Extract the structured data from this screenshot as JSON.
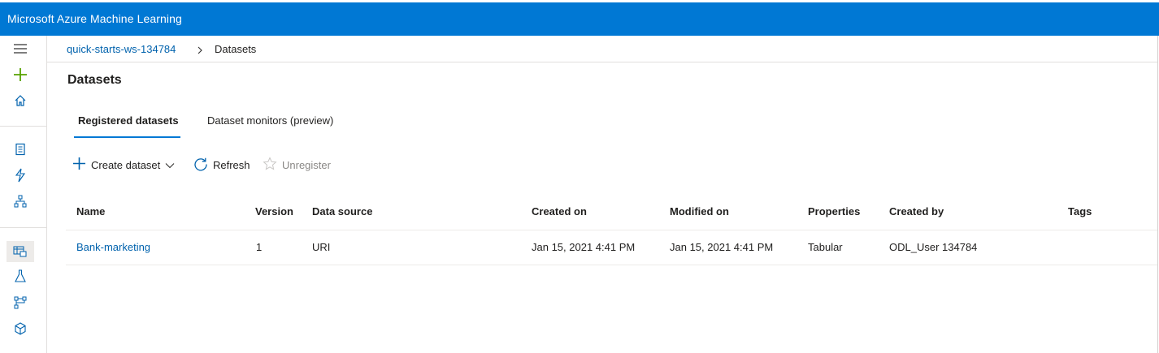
{
  "app": {
    "title": "Microsoft Azure Machine Learning"
  },
  "breadcrumb": {
    "workspace": "quick-starts-ws-134784",
    "current": "Datasets"
  },
  "page": {
    "title": "Datasets"
  },
  "tabs": [
    {
      "label": "Registered datasets",
      "active": true
    },
    {
      "label": "Dataset monitors (preview)",
      "active": false
    }
  ],
  "commands": {
    "create": "Create dataset",
    "refresh": "Refresh",
    "unregister": "Unregister"
  },
  "table": {
    "columns": [
      "Name",
      "Version",
      "Data source",
      "Created on",
      "Modified on",
      "Properties",
      "Created by",
      "Tags"
    ],
    "rows": [
      [
        "Bank-marketing",
        "1",
        "URI",
        "Jan 15, 2021 4:41 PM",
        "Jan 15, 2021 4:41 PM",
        "Tabular",
        "ODL_User 134784",
        ""
      ]
    ]
  },
  "icons": {
    "sidebar": [
      "menu-icon",
      "plus-icon",
      "home-icon",
      "notebook-icon",
      "automl-icon",
      "designer-icon",
      "datasets-icon",
      "experiments-icon",
      "pipelines-icon",
      "models-icon"
    ]
  },
  "colors": {
    "brand": "#0078d4",
    "link": "#0062ad",
    "accent_green": "#57a300"
  }
}
